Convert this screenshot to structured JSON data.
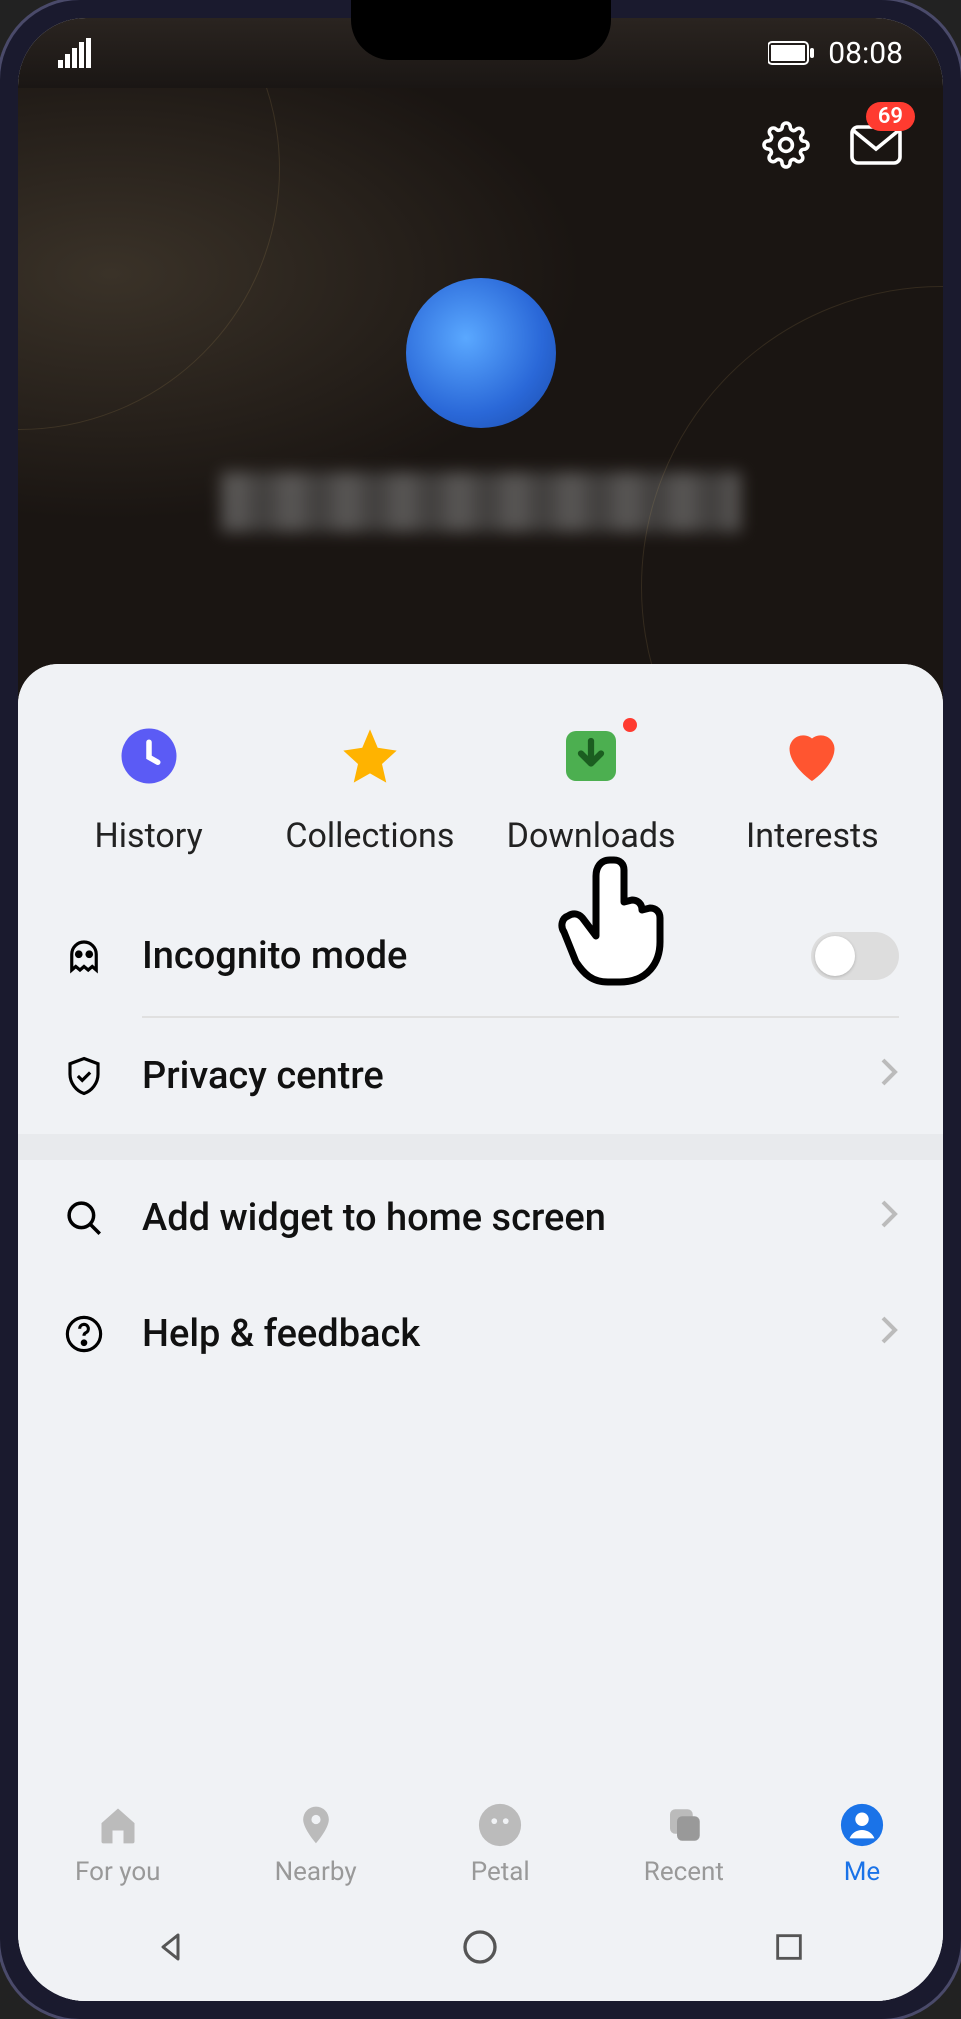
{
  "status": {
    "time": "08:08"
  },
  "header": {
    "inbox_badge": "69"
  },
  "quick": {
    "history": "History",
    "collections": "Collections",
    "downloads": "Downloads",
    "interests": "Interests"
  },
  "settings": {
    "incognito": "Incognito mode",
    "privacy": "Privacy centre",
    "widget": "Add widget to home screen",
    "help": "Help & feedback"
  },
  "nav": {
    "for_you": "For you",
    "nearby": "Nearby",
    "petal": "Petal",
    "recent": "Recent",
    "me": "Me"
  },
  "colors": {
    "accent": "#1a73e8",
    "badge": "#ff3b30",
    "history_icon": "#5b5bf5",
    "star_icon": "#ffb300",
    "download_icon": "#4caf50",
    "heart_icon": "#ff5530"
  }
}
